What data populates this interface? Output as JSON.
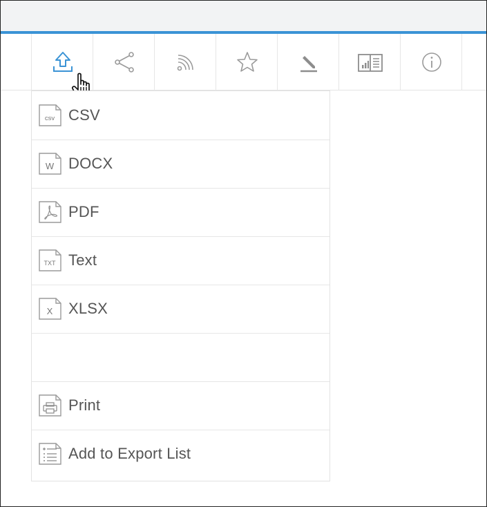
{
  "toolbar": {
    "buttons": [
      {
        "name": "export-icon",
        "active": true
      },
      {
        "name": "share-icon"
      },
      {
        "name": "rss-icon"
      },
      {
        "name": "star-icon"
      },
      {
        "name": "annotate-icon"
      },
      {
        "name": "storyboard-icon"
      },
      {
        "name": "info-icon"
      }
    ],
    "accent_color": "#3a93d5"
  },
  "export_menu": {
    "items": [
      {
        "label": "CSV",
        "icon": "csv-file-icon",
        "badge": "csv"
      },
      {
        "label": "DOCX",
        "icon": "docx-file-icon",
        "badge": "W"
      },
      {
        "label": "PDF",
        "icon": "pdf-file-icon",
        "badge": ""
      },
      {
        "label": "Text",
        "icon": "txt-file-icon",
        "badge": "TXT"
      },
      {
        "label": "XLSX",
        "icon": "xlsx-file-icon",
        "badge": "X"
      },
      {
        "label": "",
        "icon": ""
      },
      {
        "label": "Print",
        "icon": "print-icon"
      },
      {
        "label": "Add to Export List",
        "icon": "export-list-icon"
      }
    ]
  }
}
